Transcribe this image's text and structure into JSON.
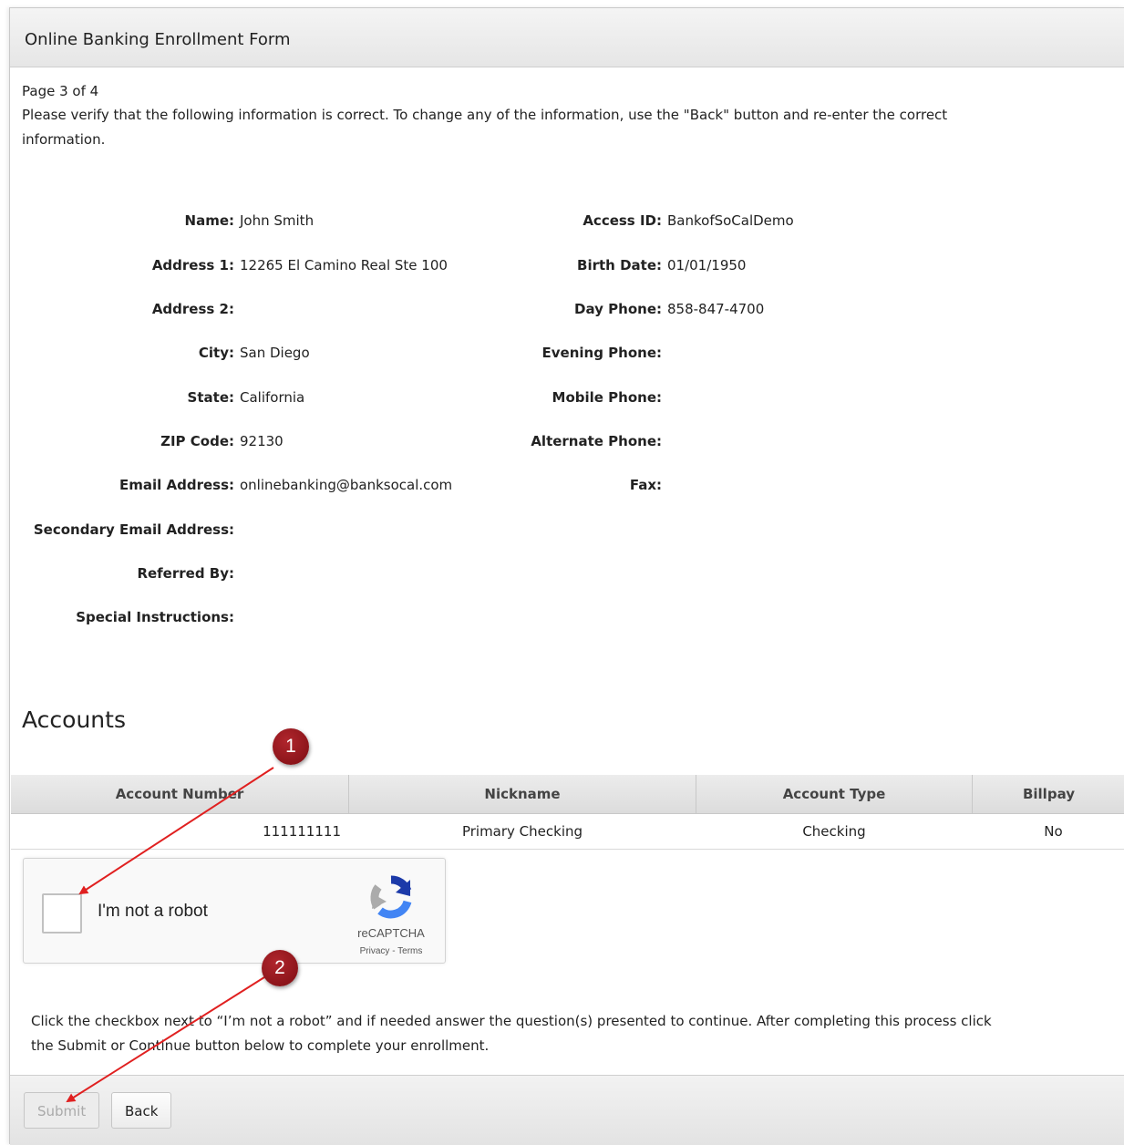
{
  "form": {
    "title": "Online Banking Enrollment Form",
    "page_indicator": "Page 3 of 4",
    "instructions_line1": "Please verify that the following information is correct. To change any of the information, use the \"Back\" button and re-enter the correct",
    "instructions_line2": "information."
  },
  "details_left": [
    {
      "label": "Name:",
      "value": "John Smith"
    },
    {
      "label": "Address 1:",
      "value": "12265 El Camino Real Ste 100"
    },
    {
      "label": "Address 2:",
      "value": ""
    },
    {
      "label": "City:",
      "value": "San Diego"
    },
    {
      "label": "State:",
      "value": "California"
    },
    {
      "label": "ZIP Code:",
      "value": "92130"
    },
    {
      "label": "Email Address:",
      "value": "onlinebanking@banksocal.com"
    },
    {
      "label": "Secondary Email Address:",
      "value": ""
    },
    {
      "label": "Referred By:",
      "value": ""
    },
    {
      "label": "Special Instructions:",
      "value": ""
    }
  ],
  "details_right": [
    {
      "label": "Access ID:",
      "value": "BankofSoCalDemo"
    },
    {
      "label": "Birth Date:",
      "value": "01/01/1950"
    },
    {
      "label": "Day Phone:",
      "value": "858-847-4700"
    },
    {
      "label": "Evening Phone:",
      "value": ""
    },
    {
      "label": "Mobile Phone:",
      "value": ""
    },
    {
      "label": "Alternate Phone:",
      "value": ""
    },
    {
      "label": "Fax:",
      "value": ""
    }
  ],
  "accounts": {
    "heading": "Accounts",
    "columns": [
      "Account Number",
      "Nickname",
      "Account Type",
      "Billpay"
    ],
    "rows": [
      [
        "111111111",
        "Primary Checking",
        "Checking",
        "No"
      ]
    ]
  },
  "recaptcha": {
    "label": "I'm not a robot",
    "brand": "reCAPTCHA",
    "privacy": "Privacy",
    "separator": " - ",
    "terms": "Terms"
  },
  "instructions": {
    "line1": "Click the checkbox next to “I’m not a robot” and if needed answer the question(s) presented to continue. After completing this process click",
    "line2": "the Submit or Continue button below to complete your enrollment."
  },
  "buttons": {
    "submit": "Submit",
    "back": "Back"
  },
  "annotations": {
    "marker1": "1",
    "marker2": "2",
    "marker_color": "#9a1a1f",
    "arrow_color": "#e02020"
  },
  "icons": {
    "recaptcha_logo": "recaptcha-logo-icon"
  }
}
